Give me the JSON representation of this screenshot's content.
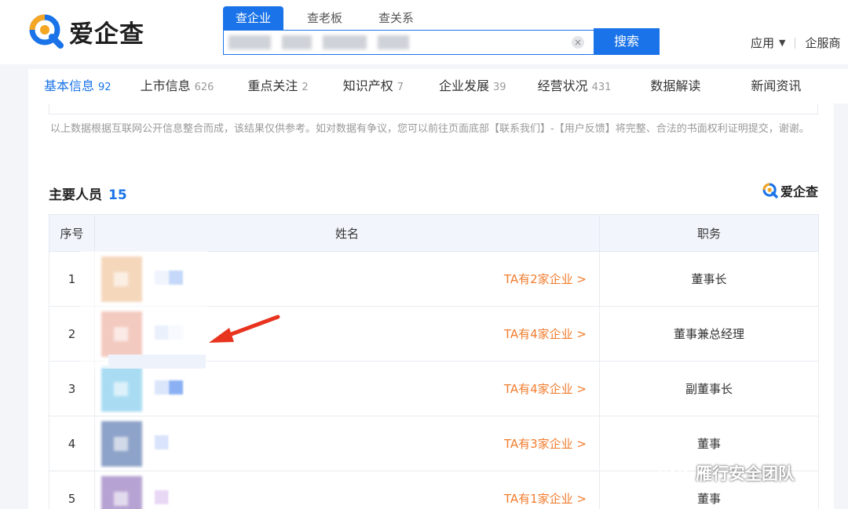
{
  "app": {
    "logo_text": "爱企查"
  },
  "search_tabs": [
    "查企业",
    "查老板",
    "查关系"
  ],
  "search": {
    "button": "搜索",
    "clear": "×"
  },
  "header_right": {
    "apps": "应用",
    "service": "企服商"
  },
  "nav": [
    {
      "label": "基本信息",
      "count": "92"
    },
    {
      "label": "上市信息",
      "count": "626"
    },
    {
      "label": "重点关注",
      "count": "2"
    },
    {
      "label": "知识产权",
      "count": "7"
    },
    {
      "label": "企业发展",
      "count": "39"
    },
    {
      "label": "经营状况",
      "count": "431"
    },
    {
      "label": "数据解读",
      "count": ""
    },
    {
      "label": "新闻资讯",
      "count": ""
    }
  ],
  "disclaimer": "以上数据根据互联网公开信息整合而成，该结果仅供参考。如对数据有争议，您可以前往页面底部【联系我们】-【用户反馈】将完整、合法的书面权利证明提交，谢谢。",
  "section": {
    "title": "主要人员",
    "count": "15",
    "brand": "爱企查"
  },
  "table": {
    "headers": [
      "序号",
      "姓名",
      "职务"
    ],
    "rows": [
      {
        "index": "1",
        "link": "TA有2家企业 >",
        "position": "董事长",
        "avatar_color": "#e9a76b"
      },
      {
        "index": "2",
        "link": "TA有4家企业 >",
        "position": "董事兼总经理",
        "avatar_color": "#e58a73"
      },
      {
        "index": "3",
        "link": "TA有4家企业 >",
        "position": "副董事长",
        "avatar_color": "#a9dcf3"
      },
      {
        "index": "4",
        "link": "TA有3家企业 >",
        "position": "董事",
        "avatar_color": "#8ea3c9"
      },
      {
        "index": "5",
        "link": "TA有1家企业 >",
        "position": "董事",
        "avatar_color": "#b7a3d3"
      }
    ]
  },
  "watermark": "雁行安全团队",
  "colors": {
    "primary": "#1a73e8",
    "link_orange": "#f27c2d",
    "arrow_red": "#e8331f"
  }
}
